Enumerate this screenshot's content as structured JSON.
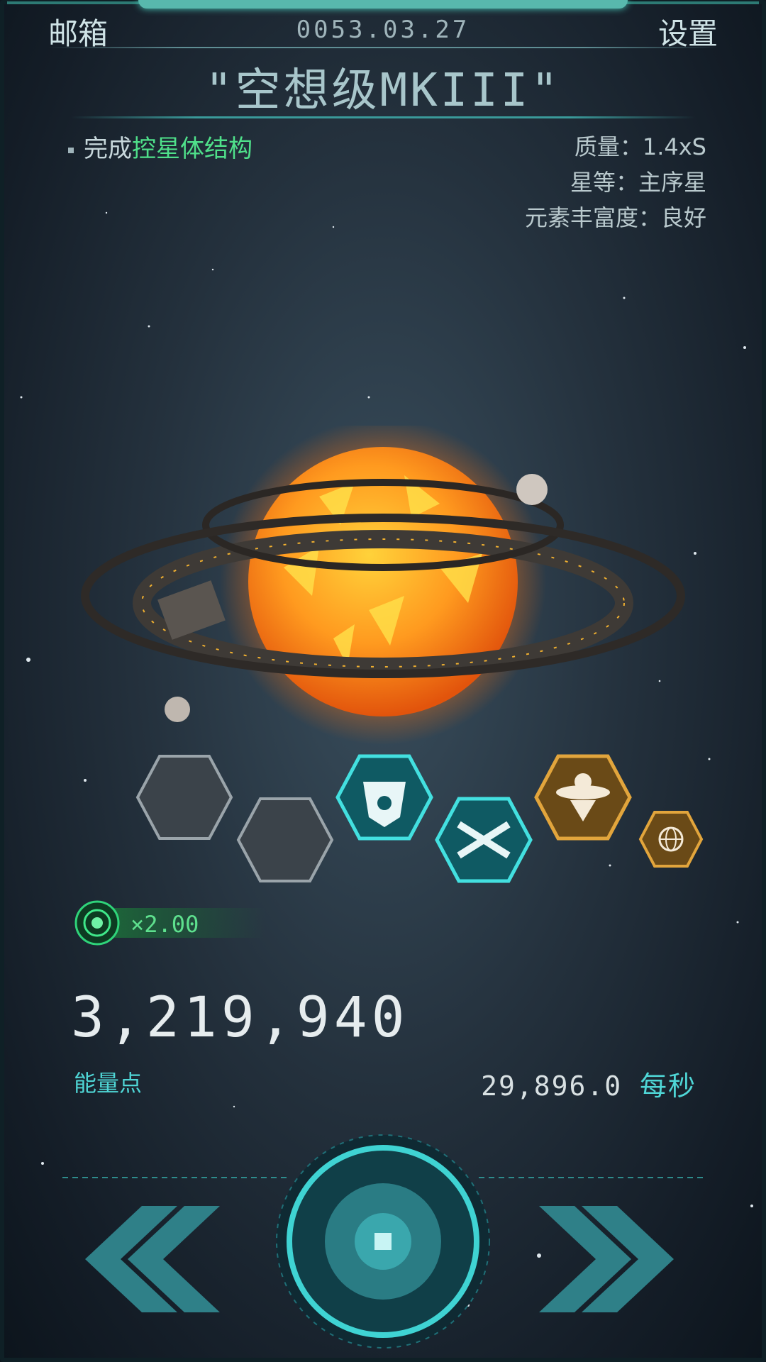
{
  "header": {
    "mail_label": "邮箱",
    "date": "0053.03.27",
    "settings_label": "设置"
  },
  "title": "\"空想级MKIII\"",
  "mission": {
    "prefix": "完成",
    "target": "控星体结构"
  },
  "stats": {
    "mass": "质量：1.4xS",
    "grade": "星等：主序星",
    "abundance": "元素丰富度：良好"
  },
  "multiplier": "×2.00",
  "energy": {
    "value": "3,219,940",
    "label": "能量点",
    "rate": "29,896.0",
    "rate_unit": "每秒"
  },
  "icons": {
    "slots": [
      "empty-slot-icon",
      "empty-slot-icon",
      "robot-mask-icon",
      "x-wing-icon",
      "ufo-emblem-icon",
      "globe-icon"
    ],
    "nav_left": "double-chevron-left-icon",
    "nav_right": "double-chevron-right-icon",
    "center": "stop-square-icon"
  },
  "colors": {
    "accent": "#3fd3d3",
    "highlight": "#4fe08a",
    "gold": "#c98f2c",
    "star": "#ff8c1a"
  }
}
